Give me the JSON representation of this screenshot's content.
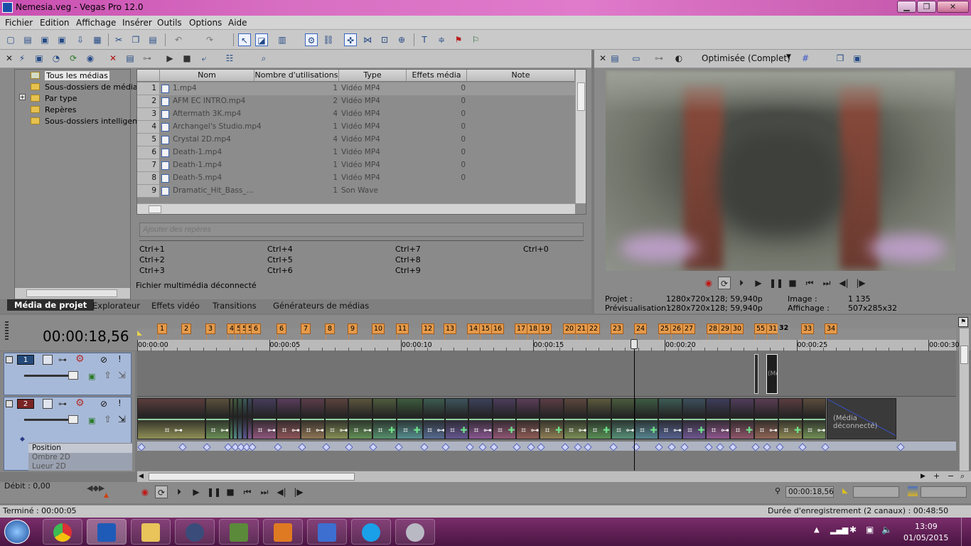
{
  "window": {
    "title": "Nemesia.veg - Vegas Pro 12.0",
    "controls": [
      "▁",
      "❐",
      "✕"
    ]
  },
  "menu": [
    "Fichier",
    "Edition",
    "Affichage",
    "Insérer",
    "Outils",
    "Options",
    "Aide"
  ],
  "tree": {
    "items": [
      {
        "label": "Tous les médias",
        "selected": true
      },
      {
        "label": "Sous-dossiers de médias"
      },
      {
        "label": "Par type",
        "expander": "+"
      },
      {
        "label": "Repères"
      },
      {
        "label": "Sous-dossiers intelligents"
      }
    ]
  },
  "media_table": {
    "columns": [
      "Nom",
      "Nombre d'utilisations",
      "Type",
      "Effets média",
      "Note"
    ],
    "rows": [
      {
        "n": "1",
        "name": "1.mp4",
        "uses": "1",
        "type": "Vidéo MP4",
        "fx": "0"
      },
      {
        "n": "2",
        "name": "AFM EC INTRO.mp4",
        "uses": "2",
        "type": "Vidéo MP4",
        "fx": "0"
      },
      {
        "n": "3",
        "name": "Aftermath 3K.mp4",
        "uses": "4",
        "type": "Vidéo MP4",
        "fx": "0"
      },
      {
        "n": "4",
        "name": "Archangel's Studio.mp4",
        "uses": "1",
        "type": "Vidéo MP4",
        "fx": "0"
      },
      {
        "n": "5",
        "name": "Crystal 2D.mp4",
        "uses": "4",
        "type": "Vidéo MP4",
        "fx": "0"
      },
      {
        "n": "6",
        "name": "Death-1.mp4",
        "uses": "1",
        "type": "Vidéo MP4",
        "fx": "0"
      },
      {
        "n": "7",
        "name": "Death-1.mp4",
        "uses": "1",
        "type": "Vidéo MP4",
        "fx": "0"
      },
      {
        "n": "8",
        "name": "Death-5.mp4",
        "uses": "1",
        "type": "Vidéo MP4",
        "fx": "0"
      },
      {
        "n": "9",
        "name": "Dramatic_Hit_Bass_...",
        "uses": "1",
        "type": "Son Wave",
        "fx": ""
      }
    ]
  },
  "markers_panel": {
    "placeholder": "Ajouter des repères",
    "shortcuts": [
      [
        "Ctrl+1",
        "Ctrl+4",
        "Ctrl+7",
        "Ctrl+0"
      ],
      [
        "Ctrl+2",
        "Ctrl+5",
        "Ctrl+8",
        ""
      ],
      [
        "Ctrl+3",
        "Ctrl+6",
        "Ctrl+9",
        ""
      ]
    ],
    "status": "Fichier multimédia déconnecté"
  },
  "left_tabs": [
    "Média de projet",
    "Explorateur",
    "Effets vidéo",
    "Transitions",
    "Générateurs de médias"
  ],
  "preview": {
    "quality": "Optimisée (Complet)",
    "projet_label": "Projet :",
    "projet_value": "1280x720x128; 59,940p",
    "previs_label": "Prévisualisation :",
    "previs_value": "1280x720x128; 59,940p",
    "image_label": "Image :",
    "image_value": "1 135",
    "affichage_label": "Affichage :",
    "affichage_value": "507x285x32"
  },
  "timeline": {
    "timecode": "00:00:18,56",
    "ruler_ticks": [
      "00:00:00",
      "00:00:05",
      "00:00:10",
      "00:00:15",
      "00:00:20",
      "00:00:25",
      "00:00:30"
    ],
    "markers": [
      "1",
      "2",
      "3",
      "4",
      "5",
      "5",
      "5",
      "6",
      "6",
      "7",
      "8",
      "9",
      "10",
      "11",
      "12",
      "13",
      "14",
      "15",
      "16",
      "17",
      "18",
      "19",
      "20",
      "21",
      "22",
      "23",
      "24",
      "25",
      "26",
      "27",
      "28",
      "29",
      "30",
      "55",
      "31",
      "32",
      "33",
      "34"
    ],
    "track1_num": "1",
    "track2_num": "2",
    "param_label": "Position",
    "param_label2": "Ombre 2D",
    "param_label3": "Lueur 2D",
    "disconnected_clip": "(Média déconnecté)",
    "disconnected_short": "(Méd"
  },
  "bottom": {
    "rate": "Débit : 0,00",
    "cursor_time": "00:00:18,56",
    "status_left": "Terminé : 00:00:05",
    "status_right": "Durée d'enregistrement (2 canaux) : 00:48:50"
  },
  "clock": {
    "time": "13:09",
    "date": "01/05/2015"
  }
}
